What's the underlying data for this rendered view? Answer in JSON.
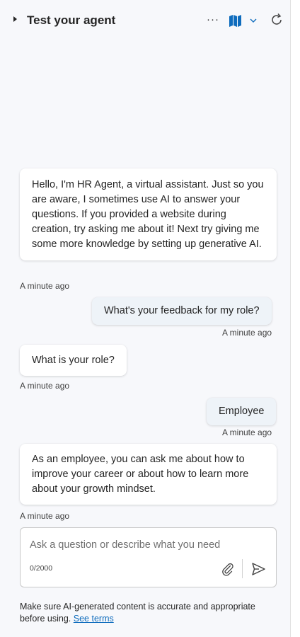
{
  "header": {
    "title": "Test your agent",
    "more_label": "···"
  },
  "messages": [
    {
      "role": "bot",
      "text": "Hello, I'm HR Agent, a virtual assistant. Just so you are aware, I sometimes use AI to answer your questions. If you provided a website during creation, try asking me about it! Next try giving me some more knowledge by setting up generative AI.",
      "time": "A minute ago"
    },
    {
      "role": "user",
      "text": "What's your feedback for my role?",
      "time": "A minute ago"
    },
    {
      "role": "bot",
      "text": "What is your role?",
      "time": "A minute ago"
    },
    {
      "role": "user",
      "text": "Employee",
      "time": "A minute ago"
    },
    {
      "role": "bot",
      "text": "As an employee, you can ask me about how to improve your career or about how to learn more about your growth mindset.",
      "time": "A minute ago"
    }
  ],
  "composer": {
    "placeholder": "Ask a question or describe what you need",
    "value": "",
    "counter": "0/2000"
  },
  "footer": {
    "disclaimer": "Make sure AI-generated content is accurate and appropriate before using.",
    "terms_link": "See terms"
  },
  "colors": {
    "accent": "#0f6cbd",
    "background": "#f7f8fb",
    "user_bubble": "#eef3f8"
  },
  "icons": [
    "caret-right-icon",
    "more-icon",
    "map-icon",
    "chevron-down-icon",
    "refresh-icon",
    "attach-icon",
    "send-icon"
  ]
}
